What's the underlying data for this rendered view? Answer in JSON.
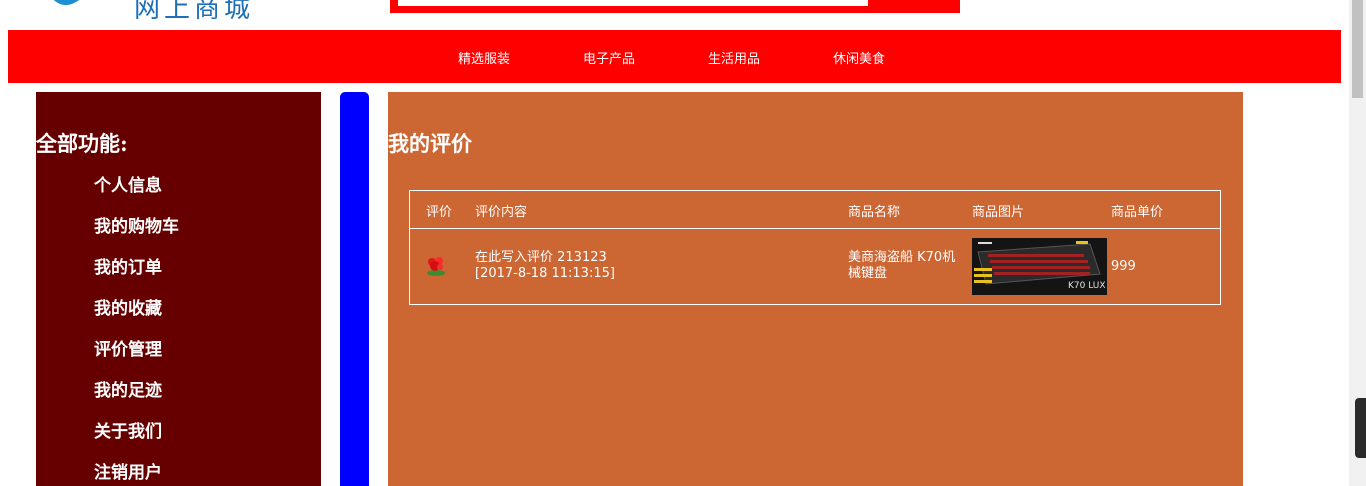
{
  "header": {
    "site_title": "网上商城",
    "search": {
      "value": "",
      "placeholder": ""
    }
  },
  "nav": {
    "items": [
      {
        "label": "精选服装"
      },
      {
        "label": "电子产品"
      },
      {
        "label": "生活用品"
      },
      {
        "label": "休闲美食"
      }
    ]
  },
  "sidebar": {
    "title": "全部功能:",
    "items": [
      {
        "label": "个人信息"
      },
      {
        "label": "我的购物车"
      },
      {
        "label": "我的订单"
      },
      {
        "label": "我的收藏"
      },
      {
        "label": "评价管理"
      },
      {
        "label": "我的足迹"
      },
      {
        "label": "关于我们"
      },
      {
        "label": "注销用户"
      }
    ]
  },
  "content": {
    "title": "我的评价",
    "table": {
      "headers": {
        "rating": "评价",
        "content": "评价内容",
        "product_name": "商品名称",
        "product_image": "商品图片",
        "unit_price": "商品单价"
      },
      "rows": [
        {
          "rating_icon": "flower-icon",
          "review_text": "在此写入评价 213123",
          "review_time": "[2017-8-18 11:13:15]",
          "product_name_line1": "美商海盗船 K70机",
          "product_name_line2": "械键盘",
          "product_image_text": "K70 LUX",
          "unit_price": "999"
        }
      ]
    }
  },
  "colors": {
    "nav": "#ff0000",
    "sidebar": "#660000",
    "divider": "#0000ff",
    "content": "#cc6633",
    "title": "#1f6fb8"
  }
}
